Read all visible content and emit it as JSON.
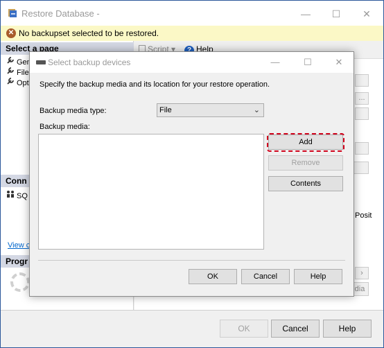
{
  "outer_window": {
    "title": "Restore Database -",
    "minimize_glyph": "—",
    "maximize_glyph": "☐",
    "close_glyph": "✕"
  },
  "warning": {
    "icon_glyph": "✕",
    "text": "No backupset selected to be restored."
  },
  "left_pane": {
    "select_page_title": "Select a page",
    "pages": [
      "Gen",
      "Files",
      "Opti"
    ],
    "connection_title": "Conn",
    "connection_item": "SQ",
    "view_link": "View co",
    "progress_title": "Progr"
  },
  "toolbar": {
    "script_label": "Script",
    "script_arrow": "▾",
    "help_label": "Help",
    "help_icon_glyph": "?"
  },
  "background_controls": {
    "browse_label": "...",
    "posit_label": "Posit",
    "dia_label": "dia",
    "scroll_right": "›"
  },
  "footer": {
    "ok_label": "OK",
    "cancel_label": "Cancel",
    "help_label": "Help"
  },
  "dialog": {
    "title": "Select backup devices",
    "minimize_glyph": "—",
    "maximize_glyph": "☐",
    "close_glyph": "✕",
    "instruction": "Specify the backup media and its location for your restore operation.",
    "media_type_label": "Backup media type:",
    "media_type_value": "File",
    "media_type_chevron": "⌄",
    "backup_media_label": "Backup media:",
    "add_label": "Add",
    "remove_label": "Remove",
    "contents_label": "Contents",
    "ok_label": "OK",
    "cancel_label": "Cancel",
    "help_label": "Help"
  },
  "colors": {
    "highlight_border": "#d0021b",
    "warning_bar": "#fbf8c6",
    "pane_header": "#d4d8e4",
    "window_border": "#2b579a"
  }
}
